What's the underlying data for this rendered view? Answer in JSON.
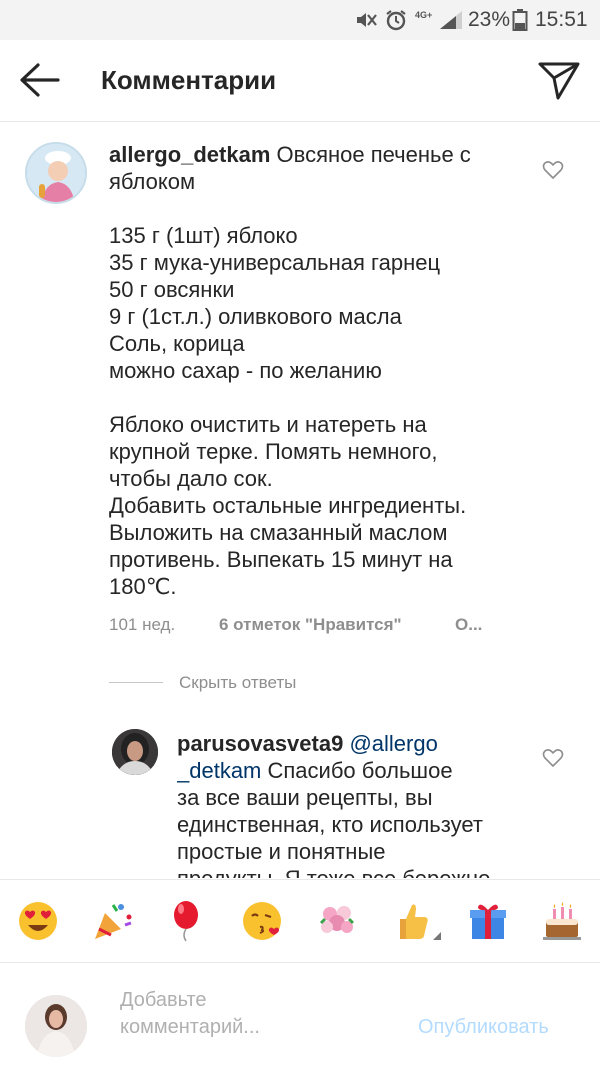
{
  "status_bar": {
    "network": "4G+",
    "battery": "23%",
    "time": "15:51"
  },
  "header": {
    "title": "Комментарии",
    "back_icon": "arrow-left-icon",
    "send_icon": "paper-plane-icon"
  },
  "comments": [
    {
      "username": "allergo_detkam",
      "text": " Овсяное печенье с\nяблоком\n\n135 г (1шт) яблоко\n35 г мука-универсальная гарнец\n50 г овсянки\n9 г (1ст.л.) оливкового масла\nСоль, корица\nможно сахар - по желанию\n\nЯблоко очистить и натереть на\nкрупной терке. Помять немного,\nчтобы дало сок.\nДобавить остальные ингредиенты.\nВыложить на смазанный маслом\nпротивень. Выпекать 15 минут на\n180℃.",
      "time": "101 нед.",
      "likes": "6 отметок \"Нравится\"",
      "more": "О..."
    }
  ],
  "replies_toggle": "Скрыть ответы",
  "reply": {
    "username": "parusovasveta9",
    "mention": "@allergo\n_detkam",
    "text": " Спасибо большое\nза все ваши рецепты, вы\nединственная, кто использует\nпростые и понятные\nпродукты. Я тоже все бережно"
  },
  "emoji_bar": [
    "heart-eyes-emoji",
    "party-popper-emoji",
    "balloon-emoji",
    "kissing-emoji",
    "bouquet-emoji",
    "thumbs-up-emoji",
    "gift-emoji",
    "birthday-cake-emoji"
  ],
  "composer": {
    "placeholder": "Добавьте\nкомментарий...",
    "publish_label": "Опубликовать"
  },
  "colors": {
    "mention": "#003569",
    "publish_disabled": "#b3dbff",
    "meta_gray": "#8e8e8e"
  }
}
